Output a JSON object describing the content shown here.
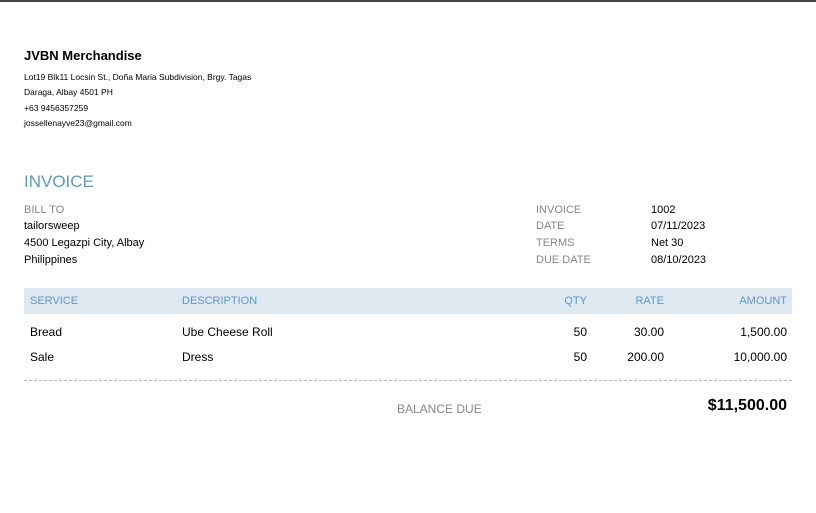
{
  "company": {
    "name": "JVBN Merchandise",
    "address_line1": "Lot19 Blk11 Locsin St., Doña Maria Subdivision, Brgy. Tagas",
    "address_line2": "Daraga, Albay  4501 PH",
    "phone": "+63 9456357259",
    "email": "jossellenayve23@gmail.com"
  },
  "invoice_title": "INVOICE",
  "bill_to": {
    "label": "BILL TO",
    "name": "tailorsweep",
    "line1": "4500 Legazpi City, Albay",
    "line2": "Philippines"
  },
  "meta": [
    {
      "label": "INVOICE",
      "value": "1002"
    },
    {
      "label": "DATE",
      "value": "07/11/2023"
    },
    {
      "label": "TERMS",
      "value": "Net 30"
    },
    {
      "label": "DUE DATE",
      "value": "08/10/2023"
    }
  ],
  "table": {
    "headers": {
      "service": "SERVICE",
      "description": "DESCRIPTION",
      "qty": "QTY",
      "rate": "RATE",
      "amount": "AMOUNT"
    },
    "rows": [
      {
        "service": "Bread",
        "description": "Ube Cheese Roll",
        "qty": "50",
        "rate": "30.00",
        "amount": "1,500.00"
      },
      {
        "service": "Sale",
        "description": "Dress",
        "qty": "50",
        "rate": "200.00",
        "amount": "10,000.00"
      }
    ]
  },
  "balance": {
    "label": "BALANCE DUE",
    "value": "$11,500.00"
  },
  "colors": {
    "accent": "#5b9ac7",
    "header_bg": "#dde8f0"
  }
}
